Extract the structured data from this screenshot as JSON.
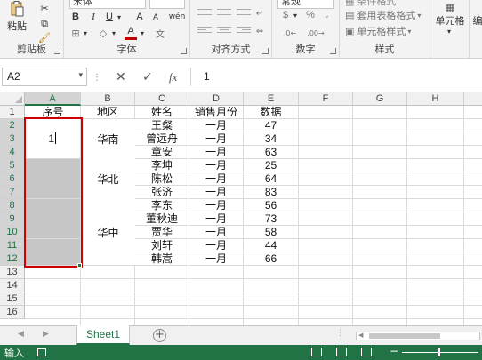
{
  "ribbon": {
    "clipboard": {
      "paste_label": "粘贴",
      "group_label": "剪贴板"
    },
    "font": {
      "font_name": "宋体",
      "font_size": "",
      "bold": "B",
      "italic": "I",
      "underline": "U",
      "grow": "A",
      "shrink": "A",
      "wen": "wén",
      "font_color_letter": "A",
      "font_color": "#c00000",
      "group_label": "字体"
    },
    "alignment": {
      "group_label": "对齐方式"
    },
    "number": {
      "format": "常规",
      "currency": "$",
      "percent": "%",
      "group_label": "数字"
    },
    "styles": {
      "conditional": "条件格式",
      "table_format": "套用表格格式",
      "cell_styles": "单元格样式",
      "group_label": "样式"
    },
    "cells": {
      "label": "单元格"
    },
    "editing": {
      "label": "编"
    }
  },
  "formula_bar": {
    "name_box": "A2",
    "cancel": "✕",
    "enter": "✓",
    "fx": "fx",
    "value": "1"
  },
  "columns": [
    "A",
    "B",
    "C",
    "D",
    "E",
    "F",
    "G",
    "H"
  ],
  "rows": [
    "1",
    "2",
    "3",
    "4",
    "5",
    "6",
    "7",
    "8",
    "9",
    "10",
    "11",
    "12",
    "13",
    "14",
    "15",
    "16"
  ],
  "headers": {
    "seq": "序号",
    "region": "地区",
    "name": "姓名",
    "month": "销售月份",
    "data": "数据"
  },
  "regions": [
    "华南",
    "华北",
    "华中"
  ],
  "records": [
    {
      "name": "王粲",
      "month": "一月",
      "value": "47"
    },
    {
      "name": "曾远舟",
      "month": "一月",
      "value": "34"
    },
    {
      "name": "章安",
      "month": "一月",
      "value": "63"
    },
    {
      "name": "李坤",
      "month": "一月",
      "value": "25"
    },
    {
      "name": "陈松",
      "month": "一月",
      "value": "64"
    },
    {
      "name": "张济",
      "month": "一月",
      "value": "83"
    },
    {
      "name": "李东",
      "month": "一月",
      "value": "56"
    },
    {
      "name": "董秋迪",
      "month": "一月",
      "value": "73"
    },
    {
      "name": "贾华",
      "month": "一月",
      "value": "58"
    },
    {
      "name": "刘轩",
      "month": "一月",
      "value": "44"
    },
    {
      "name": "韩嵩",
      "month": "一月",
      "value": "66"
    }
  ],
  "active_cell_value": "1",
  "sheet_tabs": {
    "sheet1": "Sheet1",
    "add": "+"
  },
  "status": {
    "mode": "输入",
    "zoom_minus": "−"
  },
  "colors": {
    "excel_green": "#217346",
    "selection_red": "#d00000",
    "fill_gray": "#c6c6c6"
  }
}
